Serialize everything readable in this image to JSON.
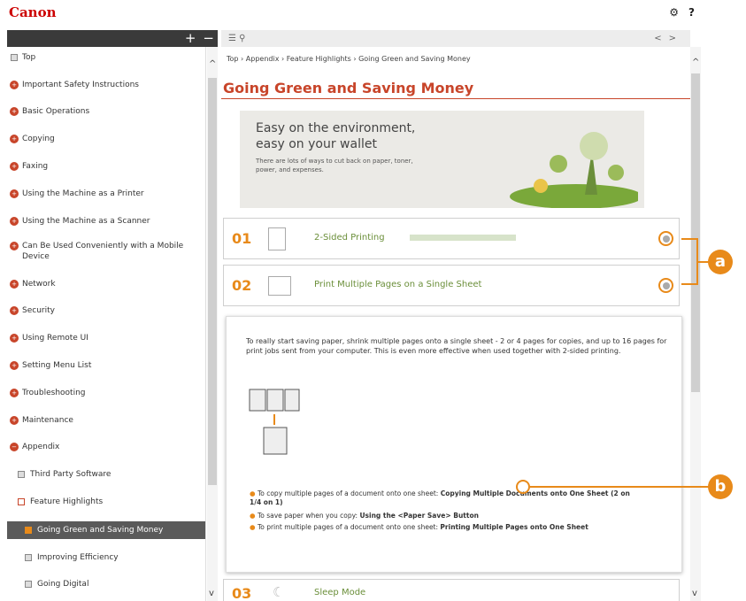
{
  "brand": "Canon",
  "header": {
    "settings_icon": "⚙",
    "help_icon": "?"
  },
  "sidebar": {
    "controls": [
      "+",
      "−"
    ],
    "items": [
      {
        "label": "Top",
        "type": "square"
      },
      {
        "label": "Important Safety Instructions",
        "type": "plus"
      },
      {
        "label": "Basic Operations",
        "type": "plus"
      },
      {
        "label": "Copying",
        "type": "plus"
      },
      {
        "label": "Faxing",
        "type": "plus"
      },
      {
        "label": "Using the Machine as a Printer",
        "type": "plus"
      },
      {
        "label": "Using the Machine as a Scanner",
        "type": "plus"
      },
      {
        "label": "Can Be Used Conveniently with a Mobile",
        "label2": "Device",
        "type": "plus"
      },
      {
        "label": "Network",
        "type": "plus"
      },
      {
        "label": "Security",
        "type": "plus"
      },
      {
        "label": "Using Remote UI",
        "type": "plus"
      },
      {
        "label": "Setting Menu List",
        "type": "plus"
      },
      {
        "label": "Troubleshooting",
        "type": "plus"
      },
      {
        "label": "Maintenance",
        "type": "plus"
      },
      {
        "label": "Appendix",
        "type": "minus"
      },
      {
        "label": "Third Party Software",
        "type": "sq2"
      },
      {
        "label": "Feature Highlights",
        "type": "sqm"
      },
      {
        "label": "Going Green and Saving Money",
        "type": "sel"
      },
      {
        "label": "Improving Efficiency",
        "type": "sq3"
      },
      {
        "label": "Going Digital",
        "type": "sq3"
      }
    ]
  },
  "toolbar": {
    "list_icon": "☰",
    "search_icon": "⚲",
    "prev": "<",
    "next": ">"
  },
  "breadcrumb": "Top › Appendix › Feature Highlights › Going Green and Saving Money",
  "title": "Going Green and Saving Money",
  "hero": {
    "line1": "Easy on the environment,",
    "line2": "easy on your wallet",
    "body": "There are lots of ways to cut back on paper, toner, power, and expenses."
  },
  "cards": [
    {
      "num": "01",
      "title": "2-Sided Printing"
    },
    {
      "num": "02",
      "title": "Print Multiple Pages on a Single Sheet"
    },
    {
      "num": "03",
      "title": "Sleep Mode"
    }
  ],
  "panel": {
    "text": "To really start saving paper, shrink multiple pages onto a single sheet - 2 or 4 pages for copies, and up to 16 pages for print jobs sent from your computer. This is even more effective when used together with 2-sided printing.",
    "bullets": [
      {
        "pre": "To copy multiple pages of a document onto one sheet: ",
        "link": "Copying Multiple Documents onto One Sheet (2 on 1/4 on 1)"
      },
      {
        "pre": "To save paper when you copy: ",
        "link": "Using the <Paper Save> Button"
      },
      {
        "pre": "To print multiple pages of a document onto one sheet: ",
        "link": "Printing Multiple Pages onto One Sheet"
      }
    ]
  },
  "callouts": {
    "a": "a",
    "b": "b"
  }
}
